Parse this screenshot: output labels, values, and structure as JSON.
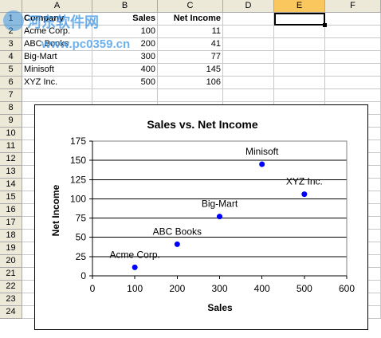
{
  "columns": [
    "A",
    "B",
    "C",
    "D",
    "E",
    "F"
  ],
  "selected_column": "E",
  "rows": [
    "1",
    "2",
    "3",
    "4",
    "5",
    "6",
    "7",
    "8",
    "9",
    "10",
    "11",
    "12",
    "13",
    "14",
    "15",
    "16",
    "17",
    "18",
    "19",
    "20",
    "21",
    "22",
    "23",
    "24"
  ],
  "header_row": [
    "Company",
    "Sales",
    "Net Income"
  ],
  "table": [
    [
      "Acme Corp.",
      "100",
      "11"
    ],
    [
      "ABC Books",
      "200",
      "41"
    ],
    [
      "Big-Mart",
      "300",
      "77"
    ],
    [
      "Minisoft",
      "400",
      "145"
    ],
    [
      "XYZ Inc.",
      "500",
      "106"
    ]
  ],
  "watermark": {
    "line1": "河东软件网",
    "line2": "www.pc0359.cn",
    "color": "#3c96e6"
  },
  "chart_data": {
    "type": "scatter",
    "title": "Sales vs. Net Income",
    "xlabel": "Sales",
    "ylabel": "Net Income",
    "xlim": [
      0,
      600
    ],
    "ylim": [
      0,
      175
    ],
    "xticks": [
      0,
      100,
      200,
      300,
      400,
      500,
      600
    ],
    "yticks": [
      0,
      25,
      50,
      75,
      100,
      125,
      150,
      175
    ],
    "grid": "horizontal",
    "point_color": "#0000ff",
    "points": [
      {
        "label": "Acme Corp.",
        "x": 100,
        "y": 11
      },
      {
        "label": "ABC Books",
        "x": 200,
        "y": 41
      },
      {
        "label": "Big-Mart",
        "x": 300,
        "y": 77
      },
      {
        "label": "Minisoft",
        "x": 400,
        "y": 145
      },
      {
        "label": "XYZ Inc.",
        "x": 500,
        "y": 106
      }
    ]
  }
}
